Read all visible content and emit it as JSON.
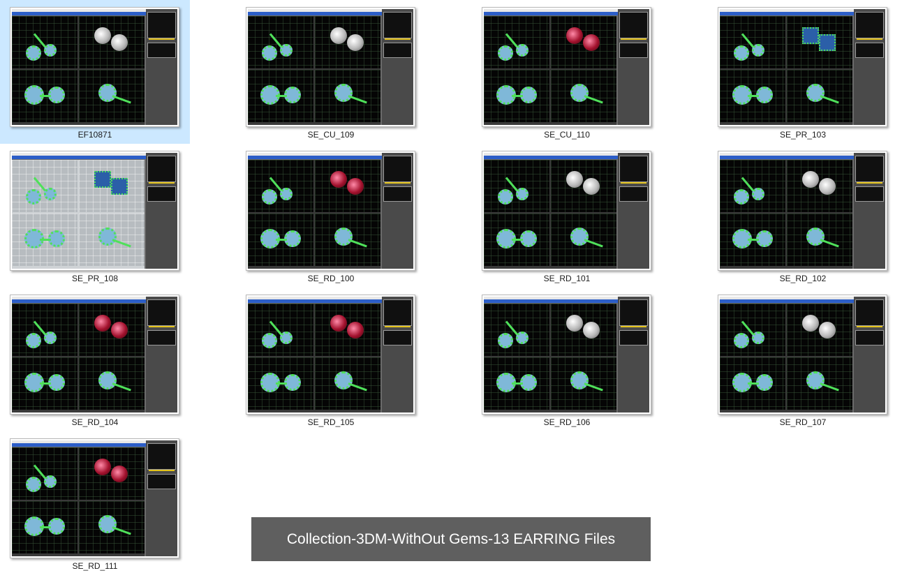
{
  "folder_view": {
    "items": [
      {
        "label": "EF10871",
        "selected": true,
        "theme": "dark",
        "gem": "white"
      },
      {
        "label": "SE_CU_109",
        "selected": false,
        "theme": "dark",
        "gem": "white"
      },
      {
        "label": "SE_CU_110",
        "selected": false,
        "theme": "dark",
        "gem": "red"
      },
      {
        "label": "SE_PR_103",
        "selected": false,
        "theme": "dark",
        "gem": "blue"
      },
      {
        "label": "SE_PR_108",
        "selected": false,
        "theme": "light",
        "gem": "blue"
      },
      {
        "label": "SE_RD_100",
        "selected": false,
        "theme": "dark",
        "gem": "red"
      },
      {
        "label": "SE_RD_101",
        "selected": false,
        "theme": "dark",
        "gem": "white"
      },
      {
        "label": "SE_RD_102",
        "selected": false,
        "theme": "dark",
        "gem": "white"
      },
      {
        "label": "SE_RD_104",
        "selected": false,
        "theme": "dark",
        "gem": "red"
      },
      {
        "label": "SE_RD_105",
        "selected": false,
        "theme": "dark",
        "gem": "red"
      },
      {
        "label": "SE_RD_106",
        "selected": false,
        "theme": "dark",
        "gem": "white"
      },
      {
        "label": "SE_RD_107",
        "selected": false,
        "theme": "dark",
        "gem": "white"
      },
      {
        "label": "SE_RD_111",
        "selected": false,
        "theme": "dark",
        "gem": "red"
      }
    ]
  },
  "banner": {
    "text": "Collection-3DM-WithOut Gems-13 EARRING Files"
  },
  "colors": {
    "selection": "#cce8ff",
    "banner_bg": "#5f5f5f",
    "wire_green": "#4fe05a",
    "viewport_bg": "#050505"
  }
}
